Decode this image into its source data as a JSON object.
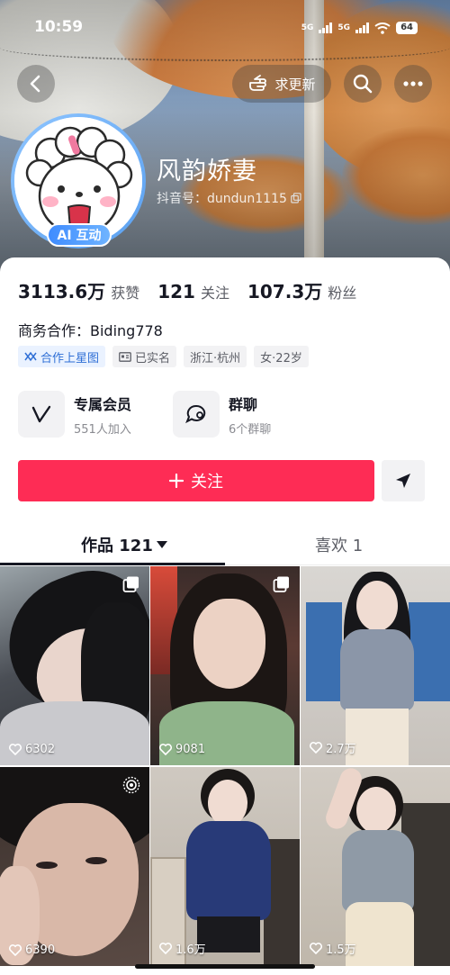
{
  "status_bar": {
    "time": "10:59",
    "network_1": "5G",
    "network_2": "5G",
    "battery": "64"
  },
  "header": {
    "update_label": "求更新"
  },
  "profile": {
    "nickname": "风韵娇妻",
    "douyin_id": "抖音号：dundun1115",
    "ai_badge": "AI 互动"
  },
  "stats": [
    {
      "value": "3113.6万",
      "label": "获赞"
    },
    {
      "value": "121",
      "label": "关注"
    },
    {
      "value": "107.3万",
      "label": "粉丝"
    }
  ],
  "business": "商务合作：Biding778",
  "tags": [
    "合作上星图",
    "已实名",
    "浙江·杭州",
    "女·22岁"
  ],
  "features": [
    {
      "title": "专属会员",
      "subtitle": "551人加入"
    },
    {
      "title": "群聊",
      "subtitle": "6个群聊"
    }
  ],
  "follow_label": "关注",
  "tabs": [
    {
      "label": "作品 121"
    },
    {
      "label": "喜欢 1"
    }
  ],
  "videos": [
    {
      "count": "6302",
      "badge": "multi-image"
    },
    {
      "count": "9081",
      "badge": "multi-image"
    },
    {
      "count": "2.7万",
      "badge": ""
    },
    {
      "count": "6390",
      "badge": "live-photo"
    },
    {
      "count": "1.6万",
      "badge": ""
    },
    {
      "count": "1.5万",
      "badge": ""
    }
  ],
  "colors": {
    "follow": "#fe2c55",
    "tag_blue": "#2f6fd6",
    "avatar_ring": "#5aa0f0"
  }
}
